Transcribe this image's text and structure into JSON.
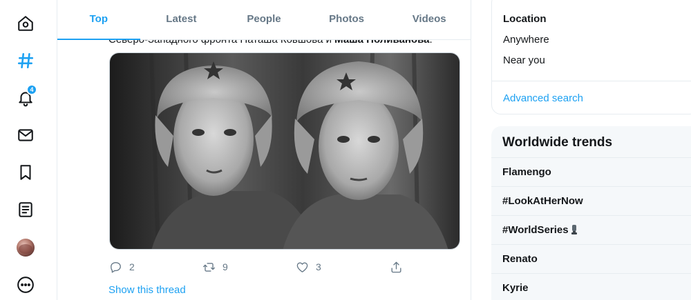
{
  "nav": {
    "items": [
      {
        "icon": "home-icon"
      },
      {
        "icon": "explore-hashtag-icon",
        "active": true
      },
      {
        "icon": "notifications-bell-icon",
        "badge": "4"
      },
      {
        "icon": "messages-envelope-icon"
      },
      {
        "icon": "bookmarks-icon"
      },
      {
        "icon": "lists-icon"
      },
      {
        "icon": "profile-avatar"
      },
      {
        "icon": "more-icon"
      }
    ],
    "accent": "#1da1f2"
  },
  "search_tabs": [
    "Top",
    "Latest",
    "People",
    "Photos",
    "Videos"
  ],
  "active_tab": "Top",
  "tweet": {
    "text_prefix": "Северо-Западного фронта Наташа Ковшова и ",
    "text_bold": "Маша Поливанова",
    "text_suffix": ".",
    "actions": {
      "reply_count": "2",
      "retweet_count": "9",
      "like_count": "3"
    },
    "show_thread": "Show this thread"
  },
  "search_filters": {
    "title": "Location",
    "options": [
      "Anywhere",
      "Near you"
    ],
    "advanced_search": "Advanced search"
  },
  "trends": {
    "title": "Worldwide trends",
    "items": [
      "Flamengo",
      "#LookAtHerNow",
      "#WorldSeries",
      "Renato",
      "Kyrie"
    ]
  },
  "colors": {
    "accent": "#1da1f2",
    "text": "#14171a",
    "muted": "#657786",
    "border": "#e6ecf0",
    "panel": "#f5f8fa"
  }
}
